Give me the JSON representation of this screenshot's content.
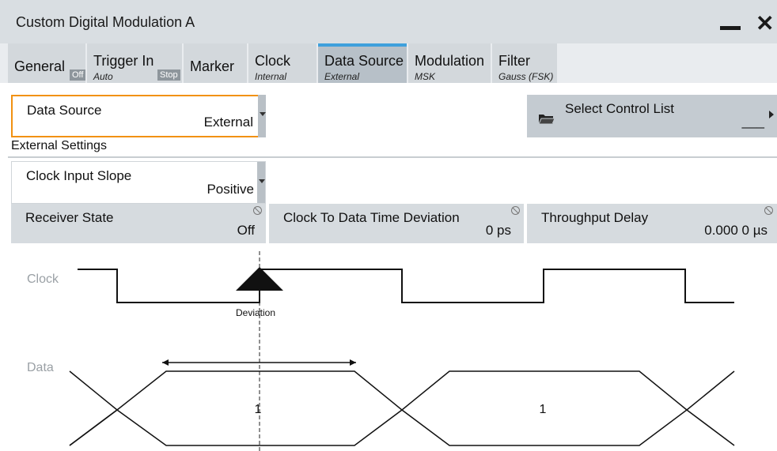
{
  "window": {
    "title": "Custom Digital Modulation A"
  },
  "tabs": [
    {
      "label": "General",
      "sub": "",
      "badge": "Off"
    },
    {
      "label": "Trigger In",
      "sub": "Auto",
      "badge": "Stop"
    },
    {
      "label": "Marker",
      "sub": "",
      "badge": ""
    },
    {
      "label": "Clock",
      "sub": "Internal",
      "badge": ""
    },
    {
      "label": "Data Source",
      "sub": "External",
      "badge": "",
      "active": true
    },
    {
      "label": "Modulation",
      "sub": "MSK",
      "badge": ""
    },
    {
      "label": "Filter",
      "sub": "Gauss (FSK)",
      "badge": ""
    }
  ],
  "data_source": {
    "label": "Data Source",
    "value": "External"
  },
  "control_list": {
    "label": "Select Control List",
    "value": "___"
  },
  "external_settings": {
    "label": "External Settings"
  },
  "clock_input_slope": {
    "label": "Clock Input Slope",
    "value": "Positive"
  },
  "receiver_state": {
    "label": "Receiver State",
    "value": "Off"
  },
  "clock_to_data": {
    "label": "Clock To Data Time Deviation",
    "value": "0 ps"
  },
  "throughput_delay": {
    "label": "Throughput Delay",
    "value": "0.000 0 µs"
  },
  "diagram": {
    "clock_label": "Clock",
    "data_label": "Data",
    "deviation_label": "Deviation",
    "bit1": "1",
    "bit2": "1"
  },
  "colors": {
    "accent": "#f29111",
    "active_tab_bar": "#3ea0dc"
  },
  "icons": {
    "folder": "folder-icon",
    "close": "close-icon",
    "minimize": "minimize-icon",
    "lock": "lock-icon"
  }
}
